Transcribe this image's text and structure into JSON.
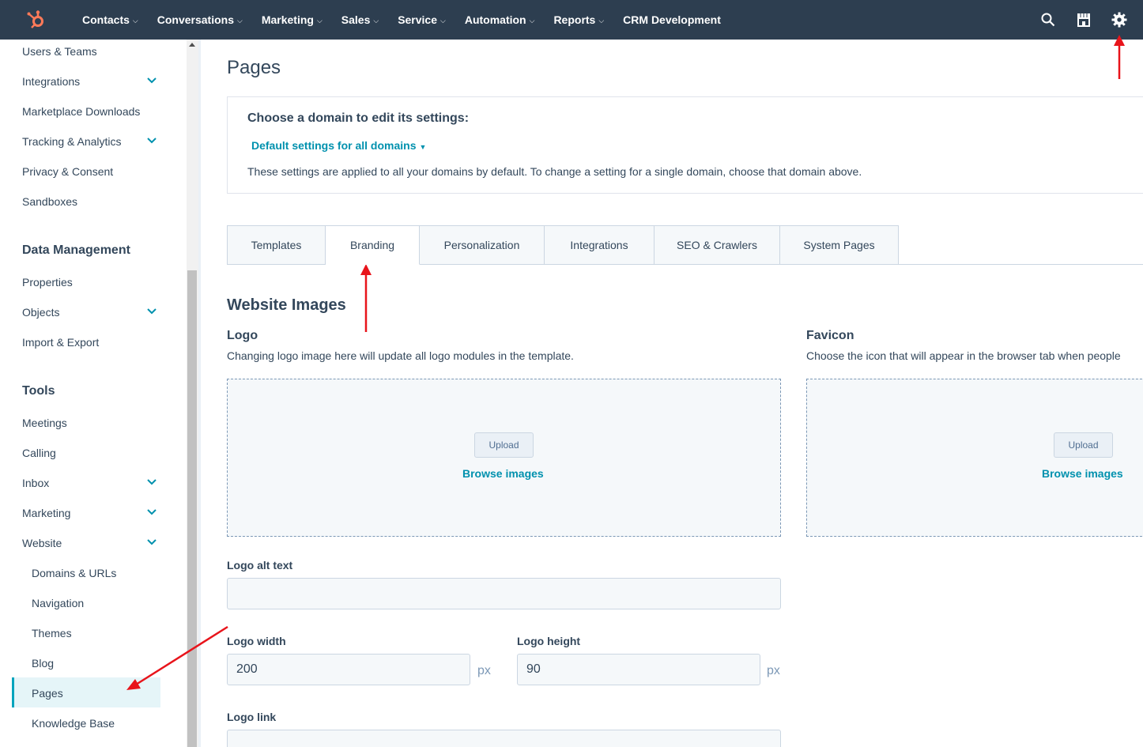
{
  "nav": {
    "items": [
      {
        "label": "Contacts",
        "caret": true
      },
      {
        "label": "Conversations",
        "caret": true
      },
      {
        "label": "Marketing",
        "caret": true
      },
      {
        "label": "Sales",
        "caret": true
      },
      {
        "label": "Service",
        "caret": true
      },
      {
        "label": "Automation",
        "caret": true
      },
      {
        "label": "Reports",
        "caret": true
      },
      {
        "label": "CRM Development",
        "caret": false
      }
    ],
    "brand_color": "#ff7a59",
    "right_icons": [
      "search-icon",
      "marketplace-icon",
      "settings-gear-icon"
    ]
  },
  "sidebar": {
    "items": [
      {
        "label": "Users & Teams"
      },
      {
        "label": "Integrations",
        "expandable": true
      },
      {
        "label": "Marketplace Downloads"
      },
      {
        "label": "Tracking & Analytics",
        "expandable": true
      },
      {
        "label": "Privacy & Consent"
      },
      {
        "label": "Sandboxes"
      }
    ],
    "data_management": {
      "heading": "Data Management",
      "items": [
        {
          "label": "Properties"
        },
        {
          "label": "Objects",
          "expandable": true
        },
        {
          "label": "Import & Export"
        }
      ]
    },
    "tools": {
      "heading": "Tools",
      "items": [
        {
          "label": "Meetings"
        },
        {
          "label": "Calling"
        },
        {
          "label": "Inbox",
          "expandable": true
        },
        {
          "label": "Marketing",
          "expandable": true
        },
        {
          "label": "Website",
          "expandable": true
        }
      ],
      "website_sub": [
        {
          "label": "Domains & URLs"
        },
        {
          "label": "Navigation"
        },
        {
          "label": "Themes"
        },
        {
          "label": "Blog"
        },
        {
          "label": "Pages",
          "active": true
        },
        {
          "label": "Knowledge Base"
        }
      ]
    }
  },
  "main": {
    "title": "Pages",
    "domain": {
      "heading": "Choose a domain to edit its settings:",
      "selected": "Default settings for all domains",
      "note": "These settings are applied to all your domains by default. To change a setting for a single domain, choose that domain above."
    },
    "tabs": [
      {
        "label": "Templates"
      },
      {
        "label": "Branding",
        "active": true
      },
      {
        "label": "Personalization"
      },
      {
        "label": "Integrations"
      },
      {
        "label": "SEO & Crawlers"
      },
      {
        "label": "System Pages"
      }
    ],
    "section_title": "Website Images",
    "logo": {
      "heading": "Logo",
      "description": "Changing logo image here will update all logo modules in the template.",
      "upload_label": "Upload",
      "browse_label": "Browse images"
    },
    "favicon": {
      "heading": "Favicon",
      "description": "Choose the icon that will appear in the browser tab when people",
      "upload_label": "Upload",
      "browse_label": "Browse images"
    },
    "fields": {
      "alt_text_label": "Logo alt text",
      "alt_text_value": "",
      "width_label": "Logo width",
      "width_value": "200",
      "height_label": "Logo height",
      "height_value": "90",
      "unit": "px",
      "link_label": "Logo link",
      "link_value": ""
    }
  },
  "accent_color": "#0091ae",
  "annotation_color": "#e8141b"
}
